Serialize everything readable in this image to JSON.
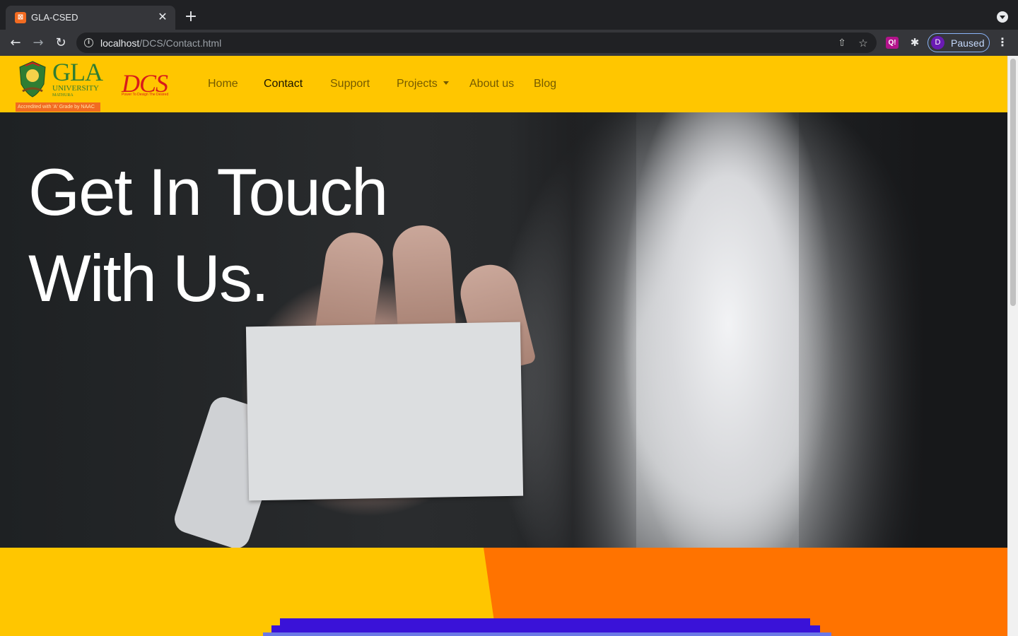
{
  "browser": {
    "tab_title": "GLA-CSED",
    "tab_favicon": "xampp-icon",
    "url_host": "localhost",
    "url_path": "/DCS/Contact.html",
    "profile_initial": "D",
    "profile_label": "Paused",
    "extension_label": "Q!"
  },
  "site": {
    "gla_logo": {
      "name": "GLA",
      "sub": "UNIVERSITY",
      "city": "MATHURA",
      "accreditation": "Accredited with 'A' Grade by NAAC"
    },
    "dcs_logo": {
      "name": "DCS",
      "tagline": "Power To Design The Desired"
    },
    "nav": [
      {
        "label": "Home",
        "active": false
      },
      {
        "label": "Contact",
        "active": true
      },
      {
        "label": "Support",
        "active": false
      },
      {
        "label": "Projects",
        "active": false,
        "dropdown": true
      },
      {
        "label": "About us",
        "active": false
      },
      {
        "label": "Blog",
        "active": false
      }
    ],
    "colors": {
      "nav_background": "#ffc600",
      "accent_orange": "#ff7300",
      "accent_blue": "#3a12d8"
    }
  },
  "hero": {
    "title_line1": "Get In Touch",
    "title_line2": "With Us."
  }
}
